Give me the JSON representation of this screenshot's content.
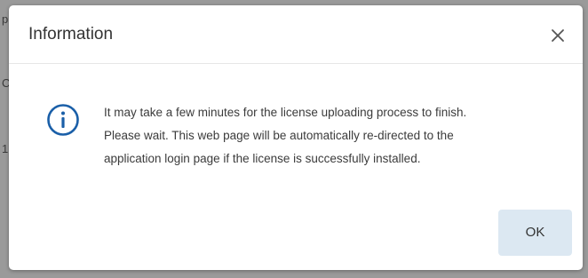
{
  "background": {
    "edge_chars": [
      "p",
      "C",
      "1"
    ]
  },
  "dialog": {
    "title": "Information",
    "close_icon": "close-icon",
    "info_icon": "info-icon",
    "message_lines": [
      "It may take a few minutes for the license uploading process to finish.",
      "Please wait. This web page will be automatically re-directed to the",
      "application login page if the license is successfully installed."
    ],
    "ok_label": "OK"
  },
  "colors": {
    "accent": "#1a5fa8",
    "ok_button_bg": "#dce8f2",
    "overlay": "#8e8e8e"
  }
}
